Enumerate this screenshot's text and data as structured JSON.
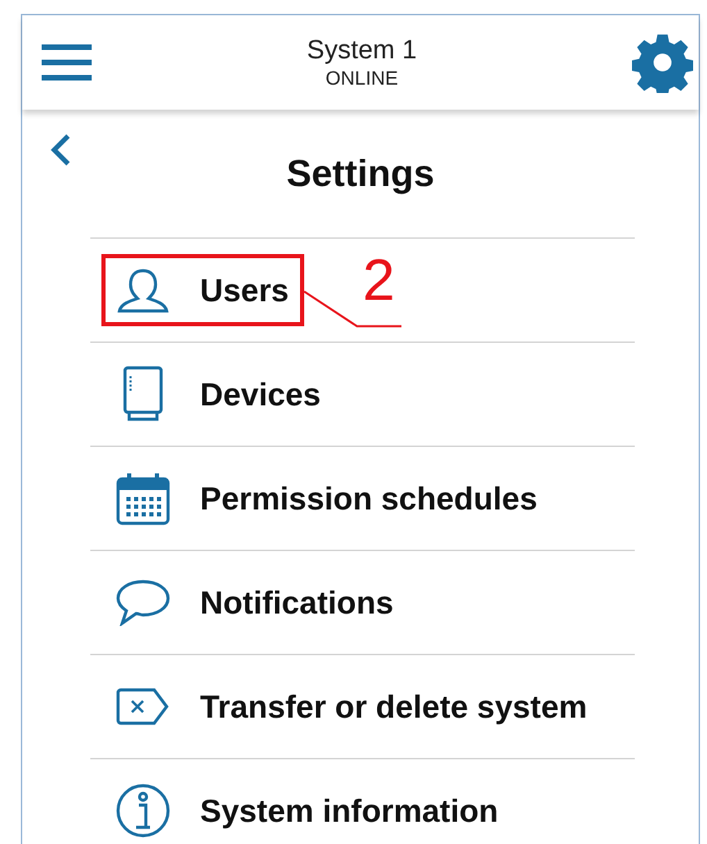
{
  "header": {
    "title": "System 1",
    "status": "ONLINE"
  },
  "page_title": "Settings",
  "items": [
    {
      "kind": "user",
      "label": "Users",
      "highlighted": true,
      "callout": "2"
    },
    {
      "kind": "device",
      "label": "Devices",
      "highlighted": false
    },
    {
      "kind": "calendar",
      "label": "Permission schedules",
      "highlighted": false
    },
    {
      "kind": "chat",
      "label": "Notifications",
      "highlighted": false
    },
    {
      "kind": "delete",
      "label": "Transfer or delete system",
      "highlighted": false
    },
    {
      "kind": "info",
      "label": "System information",
      "highlighted": false
    }
  ]
}
